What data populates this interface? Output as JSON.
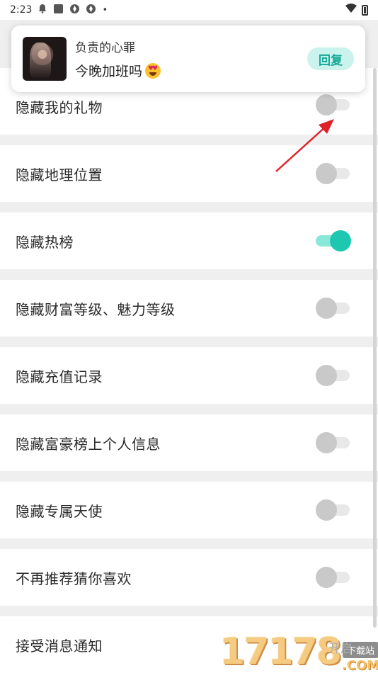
{
  "status_bar": {
    "time": "2:23",
    "icons": [
      "notification-bell-icon",
      "square-app-icon",
      "aperture-icon",
      "aperture-icon"
    ],
    "dot": "•"
  },
  "notification": {
    "sender": "负责的心罪",
    "message": "今晚加班吗",
    "emoji": "heart-eyes-emoji",
    "reply_label": "回复"
  },
  "settings": [
    {
      "label": "隐藏我的礼物",
      "enabled": false
    },
    {
      "label": "隐藏地理位置",
      "enabled": false
    },
    {
      "label": "隐藏热榜",
      "enabled": true
    },
    {
      "label": "隐藏财富等级、魅力等级",
      "enabled": false
    },
    {
      "label": "隐藏充值记录",
      "enabled": false
    },
    {
      "label": "隐藏富豪榜上个人信息",
      "enabled": false
    },
    {
      "label": "隐藏专属天使",
      "enabled": false
    },
    {
      "label": "不再推荐猜你喜欢",
      "enabled": false
    },
    {
      "label": "接受消息通知",
      "value": "开启"
    }
  ],
  "colors": {
    "accent": "#1ec8b0",
    "accent_light": "#8ae8d8",
    "toggle_off": "#c9c9c9",
    "arrow": "#e0202a"
  },
  "watermark": {
    "number": "17178",
    "badge": "下载站",
    "domain": ".COM"
  }
}
